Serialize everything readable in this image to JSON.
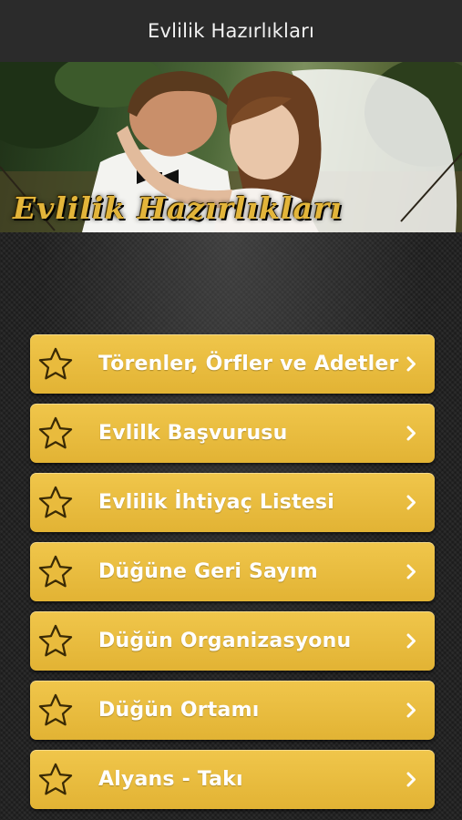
{
  "app": {
    "title": "Evlilik Hazırlıkları"
  },
  "banner": {
    "caption": "Evlilik Hazırlıkları"
  },
  "theme": {
    "accent": "#e8ba3c",
    "star_fill": "#e9bb3d",
    "star_stroke": "#3a2a05",
    "appbar_bg": "#2b2b2b"
  },
  "menu": {
    "items": [
      {
        "label": "Törenler, Örfler ve Adetler",
        "icon": "star-icon"
      },
      {
        "label": "Evlilk Başvurusu",
        "icon": "star-icon"
      },
      {
        "label": "Evlilik İhtiyaç Listesi",
        "icon": "star-icon"
      },
      {
        "label": "Düğüne Geri Sayım",
        "icon": "star-icon"
      },
      {
        "label": "Düğün Organizasyonu",
        "icon": "star-icon"
      },
      {
        "label": "Düğün Ortamı",
        "icon": "star-icon"
      },
      {
        "label": "Alyans - Takı",
        "icon": "star-icon"
      }
    ]
  }
}
